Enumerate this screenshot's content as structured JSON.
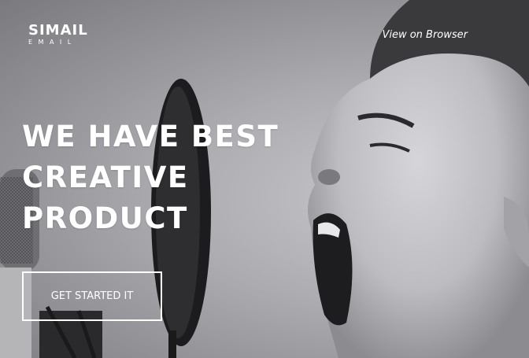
{
  "logo": {
    "main": "SIMAIL",
    "sub": "EMAIL"
  },
  "header": {
    "view_link": "View on Browser"
  },
  "hero": {
    "headline_lines": [
      "WE HAVE BEST",
      "CREATIVE",
      "PRODUCT"
    ],
    "cta_label": "GET STARTED IT"
  },
  "colors": {
    "text": "#ffffff",
    "background": "#9a9a9e"
  }
}
